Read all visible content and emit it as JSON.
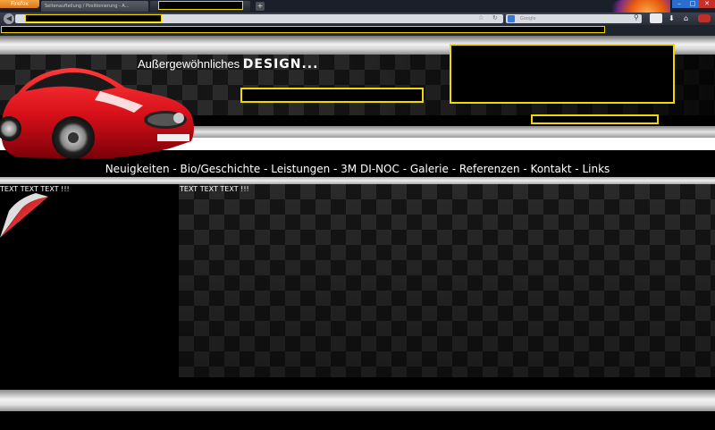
{
  "browser": {
    "app_button_label": "Firefox",
    "tabs": [
      {
        "title": "Seitenaufteilung / Positionierung - A..."
      },
      {
        "title": ""
      }
    ],
    "new_tab_label": "+",
    "window_controls": {
      "minimize": "–",
      "maximize": "□",
      "close": "✕"
    },
    "search_placeholder": "Google",
    "icons": [
      "back-icon",
      "star-icon",
      "reload-icon",
      "search-icon",
      "download-icon",
      "home-icon"
    ]
  },
  "page": {
    "tagline_prefix": "Außergewöhnliches ",
    "tagline_word": "DESIGN...",
    "nav": [
      {
        "label": "Neuigkeiten"
      },
      {
        "label": "Bio/Geschichte"
      },
      {
        "label": "Leistungen"
      },
      {
        "label": "3M DI-NOC"
      },
      {
        "label": "Galerie"
      },
      {
        "label": "Referenzen"
      },
      {
        "label": "Kontakt"
      },
      {
        "label": "Links"
      }
    ],
    "nav_separator": " - ",
    "left_column_text": "TEXT TEXT TEXT !!!",
    "right_column_text": "TEXT TEXT TEXT !!!"
  },
  "colors": {
    "redaction_border": "#f0d800",
    "car_body": "#d8101a",
    "firefox_button": "#e8891e"
  }
}
